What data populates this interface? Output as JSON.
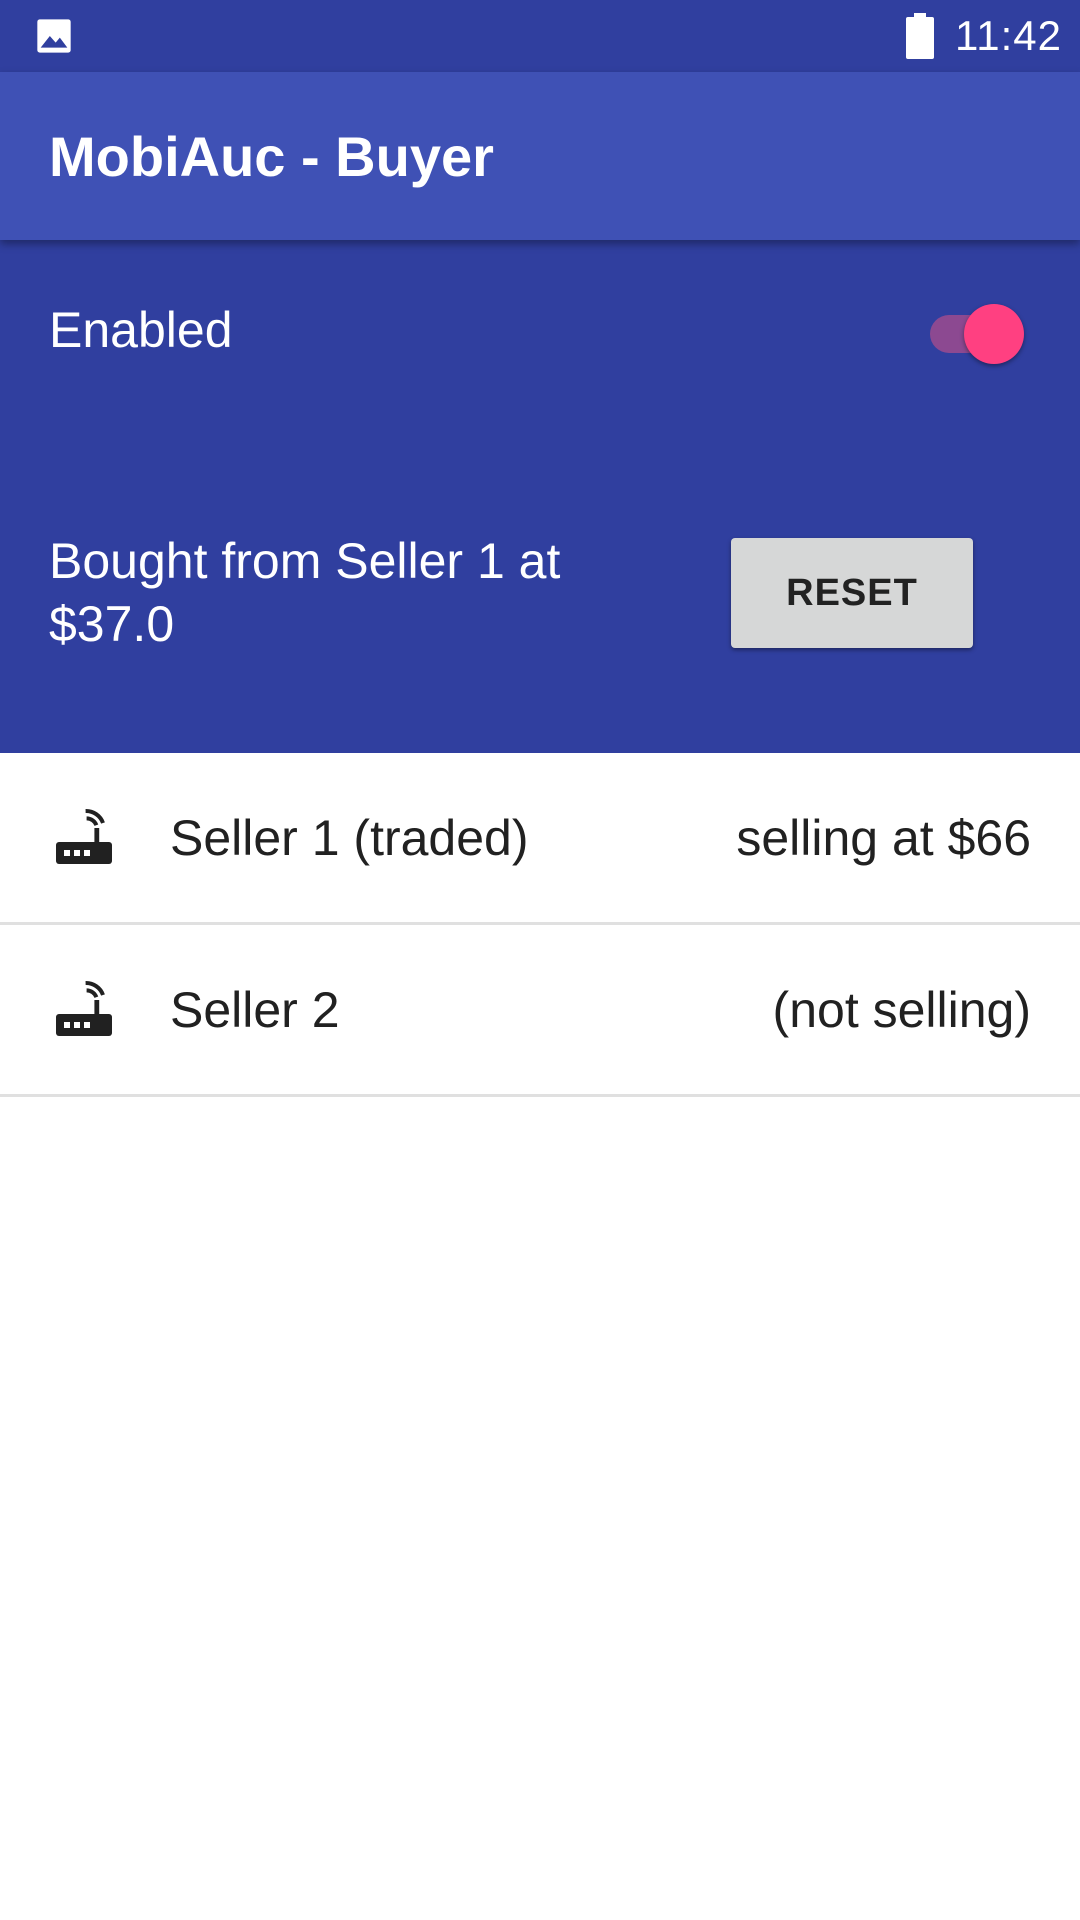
{
  "status_bar": {
    "time": "11:42",
    "left_icon": "image-icon",
    "battery_icon": "battery-icon"
  },
  "app_bar": {
    "title": "MobiAuc - Buyer"
  },
  "panel": {
    "enabled_label": "Enabled",
    "switch_on": true,
    "bought_text": "Bought from Seller 1 at $37.0",
    "reset_label": "RESET"
  },
  "sellers": [
    {
      "icon": "router-icon",
      "name": "Seller 1 (traded)",
      "status": "selling at $66"
    },
    {
      "icon": "router-icon",
      "name": "Seller 2",
      "status": "(not selling)"
    }
  ],
  "colors": {
    "primary_dark": "#303F9F",
    "primary": "#3F51B5",
    "accent": "#FF4081",
    "button_bg": "#D6D7D7"
  }
}
